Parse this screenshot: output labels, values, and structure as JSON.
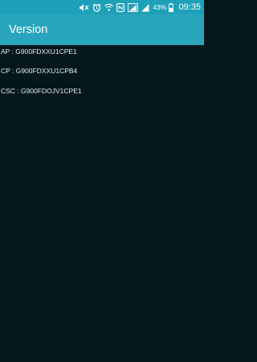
{
  "status_bar": {
    "battery_percent": "43%",
    "time": "09:35",
    "icons": [
      "mute-icon",
      "alarm-icon",
      "wifi-icon",
      "nfc-icon",
      "signal-icon",
      "signal-icon",
      "battery-icon"
    ]
  },
  "app_bar": {
    "title": "Version",
    "color": "#2aa5be"
  },
  "versions": [
    {
      "text": "AP : G900FDXXU1CPE1"
    },
    {
      "text": "CP : G900FDXXU1CPB4"
    },
    {
      "text": "CSC : G900FDOJV1CPE1"
    }
  ],
  "colors": {
    "background": "#04171b",
    "status_bar": "#1ea0b8",
    "text": "#e6eef0"
  }
}
